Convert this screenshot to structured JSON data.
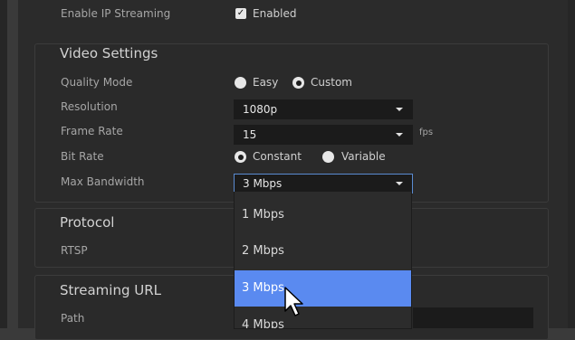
{
  "streaming": {
    "label": "Enable IP Streaming",
    "checkbox_text": "Enabled"
  },
  "video": {
    "title": "Video Settings",
    "quality_label": "Quality Mode",
    "quality_options": [
      "Easy",
      "Custom"
    ],
    "resolution_label": "Resolution",
    "resolution_value": "1080p",
    "framerate_label": "Frame Rate",
    "framerate_value": "15",
    "framerate_unit": "fps",
    "bitrate_label": "Bit Rate",
    "bitrate_options": [
      "Constant",
      "Variable"
    ],
    "bandwidth_label": "Max Bandwidth",
    "bandwidth_value": "3 Mbps",
    "bandwidth_options": [
      "1 Mbps",
      "2 Mbps",
      "3 Mbps",
      "4 Mbps"
    ]
  },
  "protocol": {
    "title": "Protocol",
    "label": "RTSP"
  },
  "url": {
    "title": "Streaming URL",
    "path_label": "Path"
  },
  "colors": {
    "accent": "#5a8af0",
    "focus_border": "#5a8bd1"
  }
}
